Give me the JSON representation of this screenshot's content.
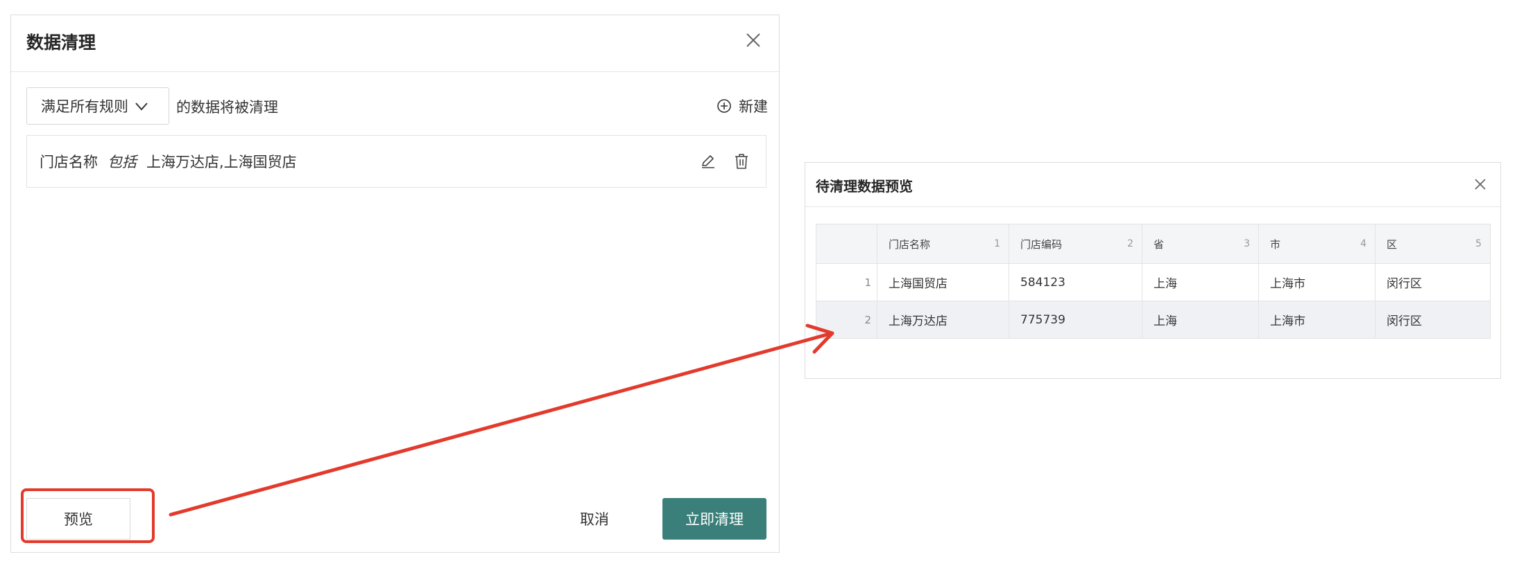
{
  "dialog": {
    "title": "数据清理",
    "mode_label": "满足所有规则",
    "rule_suffix": "的数据将被清理",
    "new_label": "新建",
    "rule": {
      "field": "门店名称",
      "operator": "包括",
      "value": "上海万达店,上海国贸店"
    },
    "preview_label": "预览",
    "cancel_label": "取消",
    "confirm_label": "立即清理"
  },
  "preview_panel": {
    "title": "待清理数据预览",
    "columns": [
      {
        "label": "门店名称",
        "num": "1"
      },
      {
        "label": "门店编码",
        "num": "2"
      },
      {
        "label": "省",
        "num": "3"
      },
      {
        "label": "市",
        "num": "4"
      },
      {
        "label": "区",
        "num": "5"
      }
    ],
    "rows": [
      {
        "idx": "1",
        "cells": [
          "上海国贸店",
          "584123",
          "上海",
          "上海市",
          "闵行区"
        ]
      },
      {
        "idx": "2",
        "cells": [
          "上海万达店",
          "775739",
          "上海",
          "上海市",
          "闵行区"
        ]
      }
    ]
  },
  "colors": {
    "accent": "#3a7f79",
    "highlight": "#e23a2c"
  }
}
